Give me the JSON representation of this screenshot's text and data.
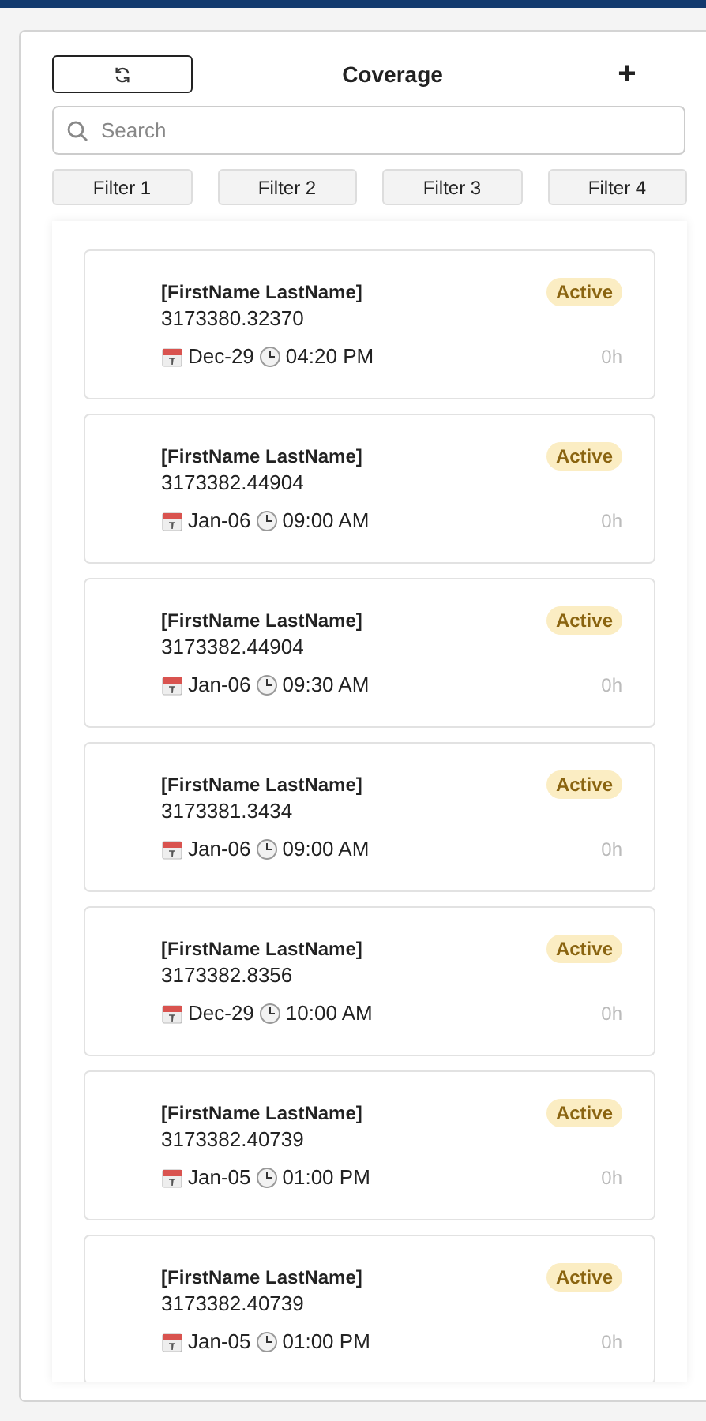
{
  "header": {
    "title": "Coverage",
    "add_label": "+"
  },
  "search": {
    "placeholder": "Search"
  },
  "filters": [
    "Filter 1",
    "Filter 2",
    "Filter 3",
    "Filter 4"
  ],
  "cards": [
    {
      "name": "[FirstName LastName]",
      "number": "3173380.32370",
      "date": "Dec-29",
      "time": "04:20 PM",
      "status": "Active",
      "hours": "0h"
    },
    {
      "name": "[FirstName LastName]",
      "number": "3173382.44904",
      "date": "Jan-06",
      "time": "09:00 AM",
      "status": "Active",
      "hours": "0h"
    },
    {
      "name": "[FirstName LastName]",
      "number": "3173382.44904",
      "date": "Jan-06",
      "time": "09:30 AM",
      "status": "Active",
      "hours": "0h"
    },
    {
      "name": "[FirstName LastName]",
      "number": "3173381.3434",
      "date": "Jan-06",
      "time": "09:00 AM",
      "status": "Active",
      "hours": "0h"
    },
    {
      "name": "[FirstName LastName]",
      "number": "3173382.8356",
      "date": "Dec-29",
      "time": "10:00 AM",
      "status": "Active",
      "hours": "0h"
    },
    {
      "name": "[FirstName LastName]",
      "number": "3173382.40739",
      "date": "Jan-05",
      "time": "01:00 PM",
      "status": "Active",
      "hours": "0h"
    },
    {
      "name": "[FirstName LastName]",
      "number": "3173382.40739",
      "date": "Jan-05",
      "time": "01:00 PM",
      "status": "Active",
      "hours": "0h"
    }
  ]
}
